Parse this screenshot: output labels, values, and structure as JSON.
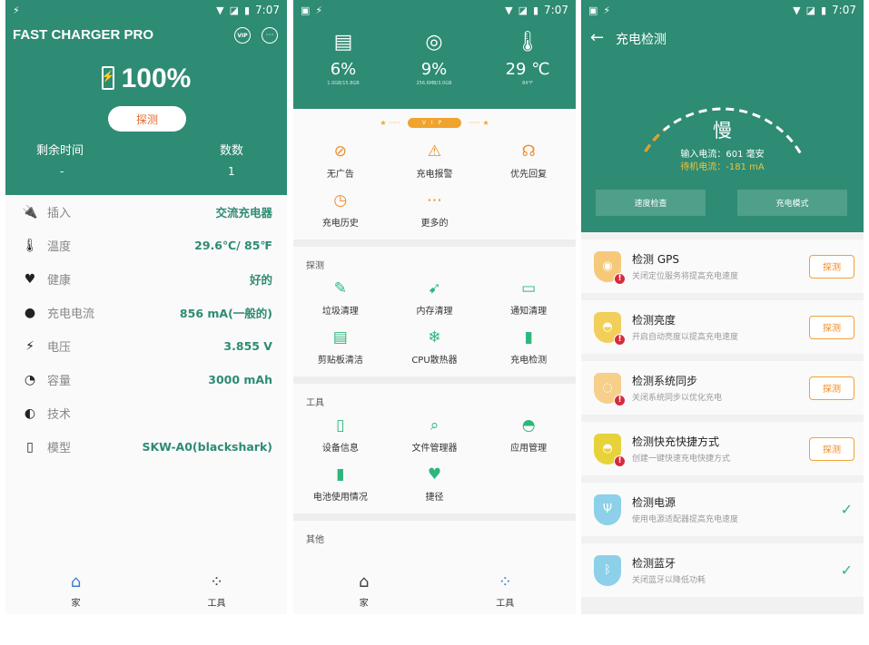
{
  "status": {
    "time": "7:07"
  },
  "p1": {
    "app_title": "FAST CHARGER PRO",
    "vip_icon_text": "VIP",
    "battery_percent": "100%",
    "detect_btn": "探测",
    "remaining_label": "剩余时间",
    "remaining_value": "-",
    "count_label": "数数",
    "count_value": "1",
    "rows": [
      {
        "label": "插入",
        "value": "交流充电器",
        "icon": "plug-icon"
      },
      {
        "label": "温度",
        "value": "29.6℃/ 85℉",
        "icon": "thermometer-icon"
      },
      {
        "label": "健康",
        "value": "好的",
        "icon": "heart-icon"
      },
      {
        "label": "充电电流",
        "value": "856 mA(一般的)",
        "icon": "bulb-icon"
      },
      {
        "label": "电压",
        "value": "3.855 V",
        "icon": "bolt-icon"
      },
      {
        "label": "容量",
        "value": "3000 mAh",
        "icon": "gauge-icon"
      },
      {
        "label": "技术",
        "value": "",
        "icon": "tech-icon"
      },
      {
        "label": "模型",
        "value": "SKW-A0(blackshark)",
        "icon": "phone-icon"
      }
    ],
    "nav": {
      "home": "家",
      "tools": "工具"
    }
  },
  "p2": {
    "stats": [
      {
        "big": "6%",
        "tiny": "1.0GB/15.8GB",
        "icon": "sdcard-icon"
      },
      {
        "big": "9%",
        "tiny": "256.6MB/3.0GB",
        "icon": "speedometer-icon"
      },
      {
        "big": "29 ℃",
        "tiny": "84°F",
        "icon": "thermometer-icon"
      }
    ],
    "vip_label": "VIP",
    "vip_items": [
      "无广告",
      "充电报警",
      "优先回复",
      "充电历史",
      "更多的"
    ],
    "section_detect": "探测",
    "detect_items": [
      "垃圾清理",
      "内存清理",
      "通知清理",
      "剪贴板清洁",
      "CPU散热器",
      "充电检测"
    ],
    "section_tools": "工具",
    "tool_items": [
      "设备信息",
      "文件管理器",
      "应用管理",
      "电池使用情况",
      "捷径"
    ],
    "section_other": "其他",
    "nav": {
      "home": "家",
      "tools": "工具"
    }
  },
  "p3": {
    "title": "充电检测",
    "speed": "慢",
    "input_current": "输入电流：601 毫安",
    "standby_current": "待机电流：-181 mA",
    "btn_speed_check": "速度检查",
    "btn_charge_mode": "充电模式",
    "gauge_level": 0.2,
    "cards": [
      {
        "title": "检测 GPS",
        "sub": "关闭定位服务将提高充电速度",
        "action": "探测"
      },
      {
        "title": "检测亮度",
        "sub": "开启自动亮度以提高充电速度",
        "action": "探测"
      },
      {
        "title": "检测系统同步",
        "sub": "关闭系统同步以优化充电",
        "action": "探测"
      },
      {
        "title": "检测快充快捷方式",
        "sub": "创建一键快速充电快捷方式",
        "action": "探测"
      },
      {
        "title": "检测电源",
        "sub": "使用电源适配器提高充电速度",
        "action": ""
      },
      {
        "title": "检测蓝牙",
        "sub": "关闭蓝牙以降低功耗",
        "action": ""
      }
    ]
  },
  "colors": {
    "teal": "#2e8b74",
    "orange": "#f08a24",
    "green": "#2eb67d",
    "blue": "#3a7bd5"
  }
}
